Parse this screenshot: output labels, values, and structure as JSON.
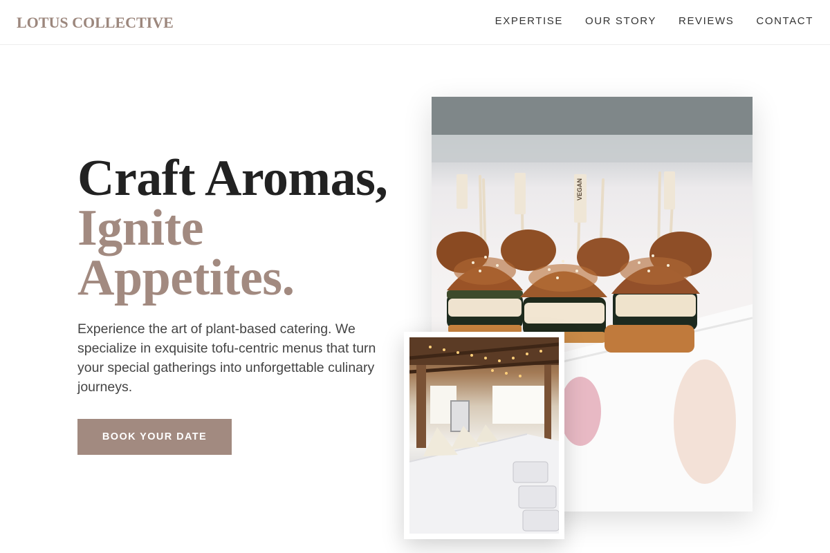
{
  "brand": {
    "name": "LOTUS COLLECTIVE"
  },
  "nav": {
    "items": [
      {
        "label": "EXPERTISE"
      },
      {
        "label": "OUR STORY"
      },
      {
        "label": "REVIEWS"
      },
      {
        "label": "CONTACT"
      }
    ]
  },
  "hero": {
    "headline_line1": "Craft Aromas,",
    "headline_line2": "Ignite",
    "headline_line3": "Appetites.",
    "description": "Experience the art of plant-based catering. We specialize in exquisite tofu-centric menus that turn your special gatherings into unforgettable culinary journeys.",
    "cta_label": "BOOK YOUR DATE"
  },
  "images": {
    "main_pick_label": "VEGAN"
  },
  "colors": {
    "accent": "#a28a80",
    "brand": "#9c877d",
    "heading_dark": "#222222",
    "body_text": "#444444"
  }
}
